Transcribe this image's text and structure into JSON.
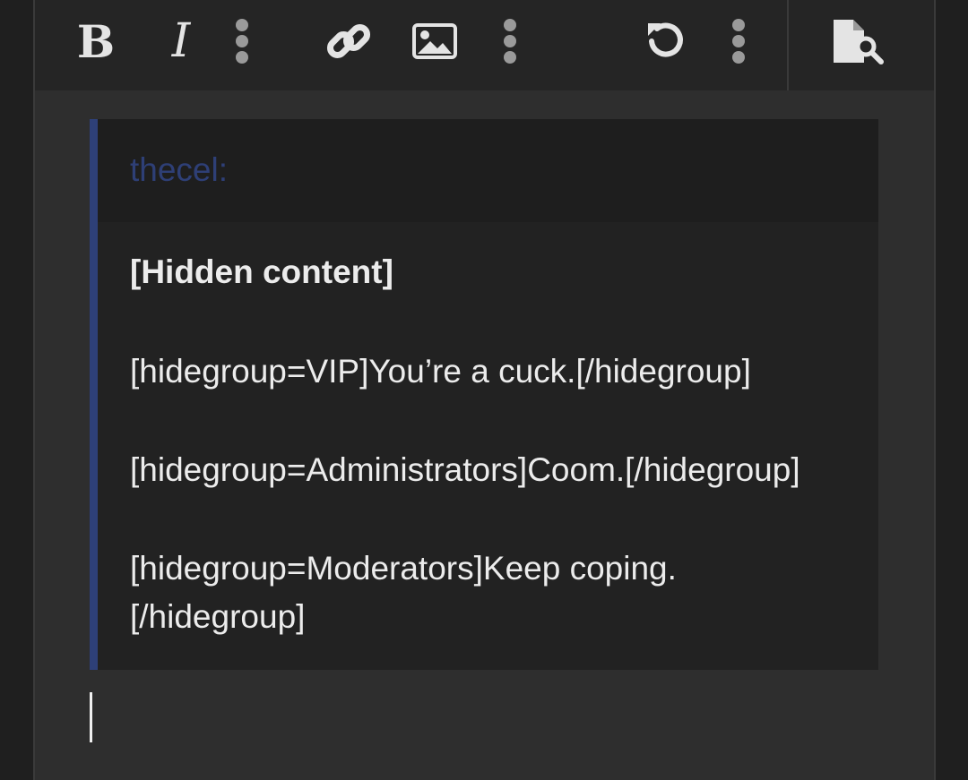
{
  "toolbar": {
    "bold": {
      "label": "B",
      "icon": "bold-icon"
    },
    "italic": {
      "label": "I",
      "icon": "italic-icon"
    },
    "more_text": {
      "icon": "more-vertical-icon"
    },
    "link": {
      "icon": "link-icon"
    },
    "image": {
      "icon": "image-icon"
    },
    "more_insert": {
      "icon": "more-vertical-icon"
    },
    "undo": {
      "icon": "undo-icon"
    },
    "more_options": {
      "icon": "more-vertical-icon"
    },
    "preview": {
      "icon": "preview-document-icon"
    }
  },
  "quote": {
    "author": "thecel:",
    "lines": [
      "[Hidden content]",
      "[hidegroup=VIP]You’re a cuck.[/hidegroup]",
      "[hidegroup=Administrators]Coom.[/hidegroup]",
      "[hidegroup=Moderators]Keep coping.",
      "[/hidegroup]"
    ]
  },
  "colors": {
    "background": "#2e2e2e",
    "toolbar": "#252525",
    "quote_bar": "#2e4078",
    "author": "#2e3f76",
    "text": "#ececec"
  }
}
